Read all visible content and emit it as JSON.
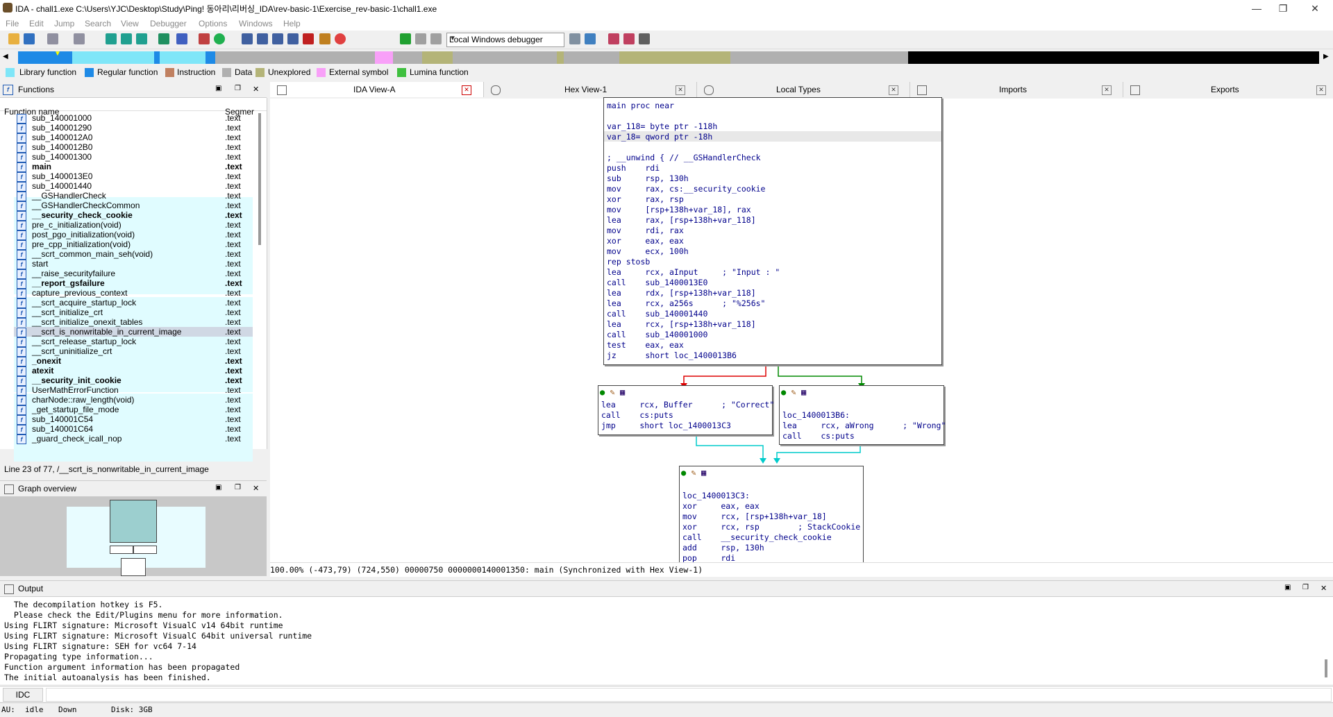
{
  "window": {
    "title": "IDA - chall1.exe C:\\Users\\YJC\\Desktop\\Study\\Ping! 동아리\\리버싱_IDA\\rev-basic-1\\Exercise_rev-basic-1\\chall1.exe",
    "min": "—",
    "max": "❐",
    "close": "✕"
  },
  "menu": [
    "File",
    "Edit",
    "Jump",
    "Search",
    "View",
    "Debugger",
    "Options",
    "Windows",
    "Help"
  ],
  "toolbar": {
    "debugger": "Local Windows debugger"
  },
  "legend": [
    {
      "label": "Library function",
      "color": "#7fe6f8"
    },
    {
      "label": "Regular function",
      "color": "#1e8ae6"
    },
    {
      "label": "Instruction",
      "color": "#c08060"
    },
    {
      "label": "Data",
      "color": "#b0b0b0"
    },
    {
      "label": "Unexplored",
      "color": "#b4b478"
    },
    {
      "label": "External symbol",
      "color": "#f8a0f8"
    },
    {
      "label": "Lumina function",
      "color": "#40c040"
    }
  ],
  "functions": {
    "title": "Functions",
    "col_name": "Function name",
    "col_seg": "Segmer",
    "rows": [
      {
        "name": "sub_140001000",
        "seg": ".text",
        "bold": false
      },
      {
        "name": "sub_140001290",
        "seg": ".text",
        "bold": false
      },
      {
        "name": "sub_1400012A0",
        "seg": ".text",
        "bold": false
      },
      {
        "name": "sub_1400012B0",
        "seg": ".text",
        "bold": false
      },
      {
        "name": "sub_140001300",
        "seg": ".text",
        "bold": false
      },
      {
        "name": "main",
        "seg": ".text",
        "bold": true
      },
      {
        "name": "sub_1400013E0",
        "seg": ".text",
        "bold": false
      },
      {
        "name": "sub_140001440",
        "seg": ".text",
        "bold": false
      },
      {
        "name": "__GSHandlerCheck",
        "seg": ".text",
        "bold": false
      },
      {
        "name": "__GSHandlerCheckCommon",
        "seg": ".text",
        "bold": false
      },
      {
        "name": "__security_check_cookie",
        "seg": ".text",
        "bold": true
      },
      {
        "name": "pre_c_initialization(void)",
        "seg": ".text",
        "bold": false
      },
      {
        "name": "post_pgo_initialization(void)",
        "seg": ".text",
        "bold": false
      },
      {
        "name": "pre_cpp_initialization(void)",
        "seg": ".text",
        "bold": false
      },
      {
        "name": "__scrt_common_main_seh(void)",
        "seg": ".text",
        "bold": false
      },
      {
        "name": "start",
        "seg": ".text",
        "bold": false
      },
      {
        "name": "__raise_securityfailure",
        "seg": ".text",
        "bold": false
      },
      {
        "name": "__report_gsfailure",
        "seg": ".text",
        "bold": true
      },
      {
        "name": "capture_previous_context",
        "seg": ".text",
        "bold": false
      },
      {
        "name": "__scrt_acquire_startup_lock",
        "seg": ".text",
        "bold": false
      },
      {
        "name": "__scrt_initialize_crt",
        "seg": ".text",
        "bold": false
      },
      {
        "name": "__scrt_initialize_onexit_tables",
        "seg": ".text",
        "bold": false
      },
      {
        "name": "__scrt_is_nonwritable_in_current_image",
        "seg": ".text",
        "bold": false
      },
      {
        "name": "__scrt_release_startup_lock",
        "seg": ".text",
        "bold": false
      },
      {
        "name": "__scrt_uninitialize_crt",
        "seg": ".text",
        "bold": false
      },
      {
        "name": "_onexit",
        "seg": ".text",
        "bold": true
      },
      {
        "name": "atexit",
        "seg": ".text",
        "bold": true
      },
      {
        "name": "__security_init_cookie",
        "seg": ".text",
        "bold": true
      },
      {
        "name": "UserMathErrorFunction",
        "seg": ".text",
        "bold": false
      },
      {
        "name": "charNode::raw_length(void)",
        "seg": ".text",
        "bold": false
      },
      {
        "name": "_get_startup_file_mode",
        "seg": ".text",
        "bold": false
      },
      {
        "name": "sub_140001C54",
        "seg": ".text",
        "bold": false
      },
      {
        "name": "sub_140001C64",
        "seg": ".text",
        "bold": false
      },
      {
        "name": "_guard_check_icall_nop",
        "seg": ".text",
        "bold": false
      }
    ],
    "status": "Line 23 of 77, /__scrt_is_nonwritable_in_current_image"
  },
  "graph_overview": {
    "title": "Graph overview"
  },
  "tabs": [
    {
      "label": "IDA View-A",
      "close": "✕"
    },
    {
      "label": "Hex View-1",
      "close": "✕"
    },
    {
      "label": "Local Types",
      "close": "✕"
    },
    {
      "label": "Imports",
      "close": "✕"
    },
    {
      "label": "Exports",
      "close": "✕"
    }
  ],
  "graph": {
    "node1": [
      "main proc near",
      "",
      "var_118= byte ptr -118h",
      "var_18= qword ptr -18h",
      "",
      "; __unwind { // __GSHandlerCheck",
      "push    rdi",
      "sub     rsp, 130h",
      "mov     rax, cs:__security_cookie",
      "xor     rax, rsp",
      "mov     [rsp+138h+var_18], rax",
      "lea     rax, [rsp+138h+var_118]",
      "mov     rdi, rax",
      "xor     eax, eax",
      "mov     ecx, 100h",
      "rep stosb",
      "lea     rcx, aInput     ; \"Input : \"",
      "call    sub_1400013E0",
      "lea     rdx, [rsp+138h+var_118]",
      "lea     rcx, a256s      ; \"%256s\"",
      "call    sub_140001440",
      "lea     rcx, [rsp+138h+var_118]",
      "call    sub_140001000",
      "test    eax, eax",
      "jz      short loc_1400013B6"
    ],
    "node2": [
      "lea     rcx, Buffer      ; \"Correct\"",
      "call    cs:puts",
      "jmp     short loc_1400013C3"
    ],
    "node3": [
      "",
      "loc_1400013B6:",
      "lea     rcx, aWrong      ; \"Wrong\"",
      "call    cs:puts"
    ],
    "node4": [
      "",
      "loc_1400013C3:",
      "xor     eax, eax",
      "mov     rcx, [rsp+138h+var_18]",
      "xor     rcx, rsp        ; StackCookie",
      "call    __security_check_cookie",
      "add     rsp, 130h",
      "pop     rdi"
    ],
    "status": "100.00% (-473,79) (724,550) 00000750 0000000140001350: main (Synchronized with Hex View-1)"
  },
  "output": {
    "title": "Output",
    "lines": [
      "  The decompilation hotkey is F5.",
      "  Please check the Edit/Plugins menu for more information.",
      "Using FLIRT signature: Microsoft VisualC v14 64bit runtime",
      "Using FLIRT signature: Microsoft VisualC 64bit universal runtime",
      "Using FLIRT signature: SEH for vc64 7-14",
      "Propagating type information...",
      "Function argument information has been propagated",
      "The initial autoanalysis has been finished."
    ],
    "idc": "IDC"
  },
  "status": {
    "au": "AU:",
    "state": "idle",
    "dir": "Down",
    "disk": "Disk: 3GB"
  }
}
